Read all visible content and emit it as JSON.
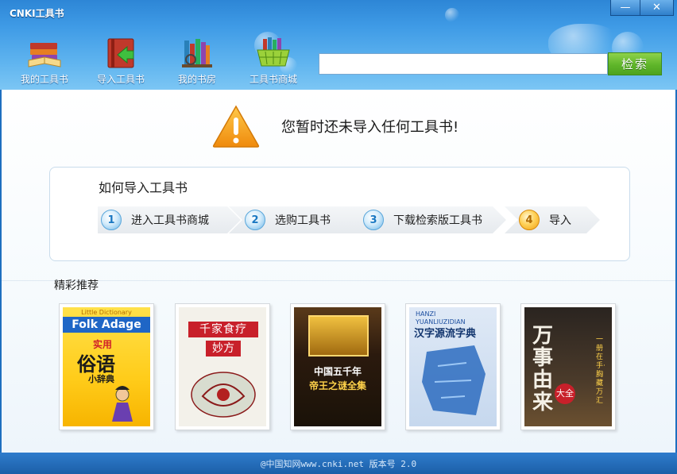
{
  "window": {
    "title": "CNKI工具书",
    "minimize_glyph": "—",
    "close_glyph": "✕"
  },
  "nav": {
    "items": [
      {
        "label": "我的工具书",
        "icon": "open-books-icon"
      },
      {
        "label": "导入工具书",
        "icon": "import-book-icon"
      },
      {
        "label": "我的书房",
        "icon": "bookshelf-icon"
      },
      {
        "label": "工具书商城",
        "icon": "shopping-basket-icon"
      }
    ]
  },
  "search": {
    "value": "",
    "button_label": "检索"
  },
  "notice": {
    "message": "您暂时还未导入任何工具书!",
    "icon": "warning-icon"
  },
  "how_to": {
    "title": "如何导入工具书",
    "steps": [
      {
        "num": "1",
        "label": "进入工具书商城"
      },
      {
        "num": "2",
        "label": "选购工具书"
      },
      {
        "num": "3",
        "label": "下载检索版工具书"
      },
      {
        "num": "4",
        "label": "导入"
      }
    ]
  },
  "recommend": {
    "title": "精彩推荐",
    "books": [
      {
        "cover_top": "Little Dictionary",
        "cover_en": "Folk Adage",
        "cover_title_1": "实用",
        "cover_title_2": "俗语",
        "cover_title_3": "小辞典"
      },
      {
        "cover_title_1": "千家食疗",
        "cover_title_2": "妙方"
      },
      {
        "cover_title_1": "中国五千年",
        "cover_title_2": "帝王之谜全集"
      },
      {
        "cover_en": "HANZI YUANLIUZIDIAN",
        "cover_title_1": "汉字源流字典"
      },
      {
        "cover_title_1": "万事由来",
        "cover_title_2": "大全",
        "cover_side": "一册在手·胸藏万汇"
      }
    ]
  },
  "footer": {
    "text": "@中国知网www.cnki.net 版本号 2.0"
  },
  "colors": {
    "header_blue": "#3f9be6",
    "search_green": "#5fb52a",
    "warning_orange": "#f39c12",
    "footer_blue": "#1c5fa8"
  }
}
